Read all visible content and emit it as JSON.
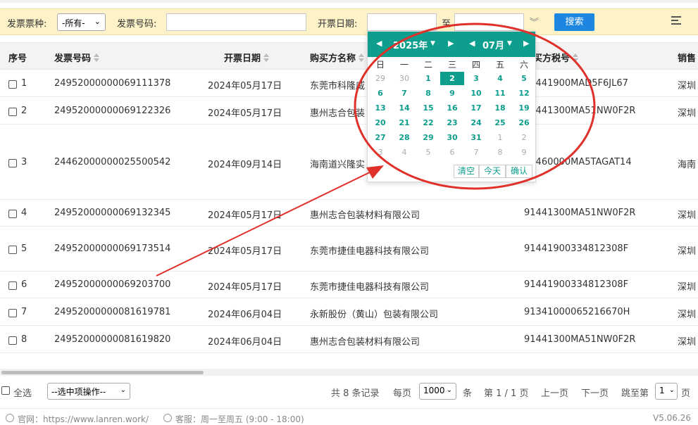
{
  "search": {
    "invoice_type_label": "发票票种:",
    "invoice_type_value": "-所有-",
    "invoice_no_label": "发票号码:",
    "invoice_no_value": "",
    "date_label": "开票日期:",
    "date_from": "",
    "date_to_label": "至",
    "date_to": "",
    "search_button": "搜索"
  },
  "table": {
    "headers": [
      "序号",
      "发票号码",
      "开票日期",
      "购买方名称",
      "购买方税号",
      "销售"
    ],
    "rows": [
      {
        "no": "1",
        "invoice": "24952000000069111378",
        "date": "2024年05月17日",
        "buyer": "东莞市科隆威",
        "tax": "91441900MAD5F6JL67",
        "seller": "深圳"
      },
      {
        "no": "2",
        "invoice": "24952000000069122326",
        "date": "2024年05月17日",
        "buyer": "惠州志合包装",
        "tax": "91441300MA51NW0F2R",
        "seller": "深圳"
      },
      {
        "no": "3",
        "invoice": "24462000000025500542",
        "date": "2024年09月14日",
        "buyer": "海南道兴隆实",
        "tax": "91460000MA5TAGAT14",
        "seller": "海南"
      },
      {
        "no": "4",
        "invoice": "24952000000069132345",
        "date": "2024年05月17日",
        "buyer": "惠州志合包装材料有限公司",
        "tax": "91441300MA51NW0F2R",
        "seller": "深圳"
      },
      {
        "no": "5",
        "invoice": "24952000000069173514",
        "date": "2024年05月17日",
        "buyer": "东莞市捷佳电器科技有限公司",
        "tax": "91441900334812308F",
        "seller": "深圳"
      },
      {
        "no": "6",
        "invoice": "24952000000069203700",
        "date": "2024年05月17日",
        "buyer": "东莞市捷佳电器科技有限公司",
        "tax": "91441900334812308F",
        "seller": "深圳"
      },
      {
        "no": "7",
        "invoice": "24952000000081619781",
        "date": "2024年06月04日",
        "buyer": "永新股份（黄山）包装有限公司",
        "tax": "91341000065216670H",
        "seller": "深圳"
      },
      {
        "no": "8",
        "invoice": "24952000000081619820",
        "date": "2024年06月04日",
        "buyer": "惠州志合包装材料有限公司",
        "tax": "91441300MA51NW0F2R",
        "seller": "深圳"
      }
    ]
  },
  "calendar": {
    "year": "2025年",
    "month": "07月",
    "weekdays": [
      "日",
      "一",
      "二",
      "三",
      "四",
      "五",
      "六"
    ],
    "days": [
      [
        "29",
        "30",
        "1",
        "2",
        "3",
        "4",
        "5"
      ],
      [
        "6",
        "7",
        "8",
        "9",
        "10",
        "11",
        "12"
      ],
      [
        "13",
        "14",
        "15",
        "16",
        "17",
        "18",
        "19"
      ],
      [
        "20",
        "21",
        "22",
        "23",
        "24",
        "25",
        "26"
      ],
      [
        "27",
        "28",
        "29",
        "30",
        "31",
        "1",
        "2"
      ],
      [
        "3",
        "4",
        "5",
        "6",
        "7",
        "8",
        "9"
      ]
    ],
    "selected_day": "2",
    "btn_clear": "清空",
    "btn_today": "今天",
    "btn_confirm": "确认",
    "accent": "#0d9e8e"
  },
  "footer": {
    "select_all": "全选",
    "bulk_action": "--选中项操作--",
    "total": "共 8 条记录",
    "per_page_label": "每页",
    "per_page_value": "1000",
    "per_page_unit": "条",
    "page_info": "第 1 / 1 页",
    "prev": "上一页",
    "next": "下一页",
    "goto_label": "跳至第",
    "goto_value": "1",
    "goto_unit": "页"
  },
  "bottom": {
    "site_label": "官网：https://www.lanren.work/",
    "service_label": "客服：周一至周五 (9:00 - 18:00)",
    "version": "V5.06.26"
  },
  "colors": {
    "search_bg": "#fdf2c8",
    "search_button": "#1c86e0",
    "annotation": "#e0302a"
  }
}
